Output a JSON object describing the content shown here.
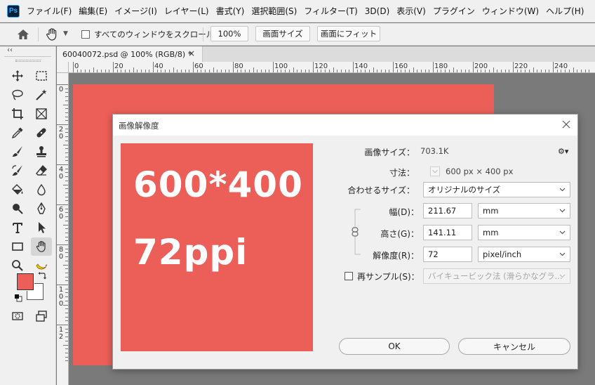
{
  "app": {
    "logo": "Ps"
  },
  "menu": [
    "ファイル(F)",
    "編集(E)",
    "イメージ(I)",
    "レイヤー(L)",
    "書式(Y)",
    "選択範囲(S)",
    "フィルター(T)",
    "3D(D)",
    "表示(V)",
    "プラグイン",
    "ウィンドウ(W)",
    "ヘルプ(H)"
  ],
  "options": {
    "scroll_all_label": "すべてのウィンドウをスクロール",
    "zoom_value": "100%",
    "actual_size_label": "画面サイズ",
    "fit_screen_label": "画面にフィット"
  },
  "toolbar": {
    "collapse": "‹‹"
  },
  "document": {
    "tab_title": "60040072.psd @ 100% (RGB/8) *",
    "close": "×",
    "canvas_color": "#ec5f58"
  },
  "rulers": {
    "h_labels": [
      "0",
      "20",
      "40",
      "60",
      "80",
      "100",
      "120",
      "140",
      "160",
      "180",
      "200",
      "220",
      "240"
    ],
    "v_labels": [
      [
        "0"
      ],
      [
        "2",
        "0"
      ],
      [
        "4",
        "0"
      ],
      [
        "6",
        "0"
      ],
      [
        "8",
        "0"
      ],
      [
        "1",
        "0",
        "0"
      ],
      [
        "1",
        "2"
      ]
    ]
  },
  "dialog": {
    "title": "画像解像度",
    "preview_lines": [
      "600*400",
      "72ppi"
    ],
    "image_size_label": "画像サイズ：",
    "image_size_value": "703.1K",
    "dimensions_label": "寸法：",
    "dimensions_value": "600 px × 400 px",
    "fit_label": "合わせるサイズ：",
    "fit_value": "オリジナルのサイズ",
    "width_label": "幅(D)：",
    "width_value": "211.67",
    "width_unit": "mm",
    "height_label": "高さ(G)：",
    "height_value": "141.11",
    "height_unit": "mm",
    "resolution_label": "解像度(R)：",
    "resolution_value": "72",
    "resolution_unit": "pixel/inch",
    "resample_label": "再サンプル(S)：",
    "resample_value": "バイキュービック法 (滑らかなグラ...",
    "ok_label": "OK",
    "cancel_label": "キャンセル"
  }
}
